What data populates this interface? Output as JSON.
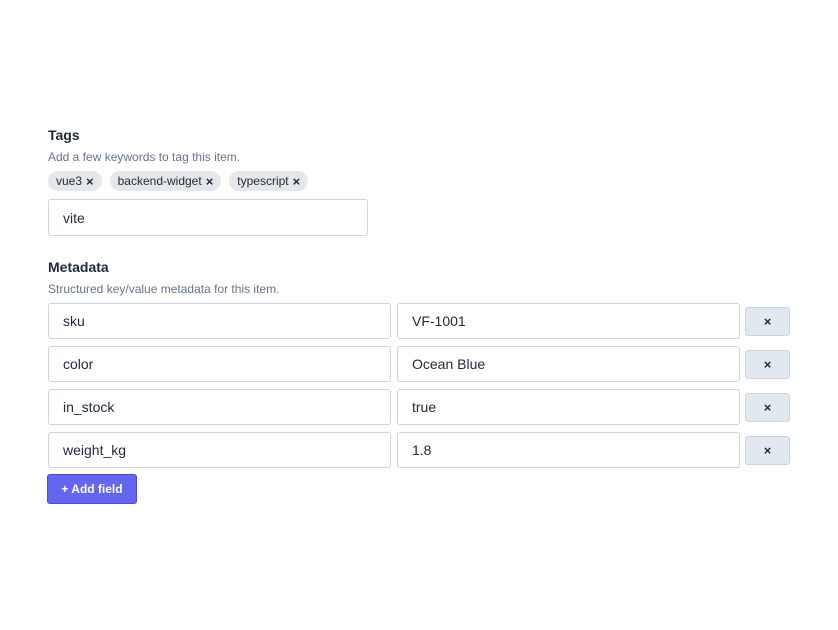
{
  "tags_section": {
    "title": "Tags",
    "help": "Add a few keywords to tag this item.",
    "tags": [
      {
        "label": "vue3",
        "remove_icon": "×"
      },
      {
        "label": "backend-widget",
        "remove_icon": "×"
      },
      {
        "label": "typescript",
        "remove_icon": "×"
      }
    ],
    "input_value": "vite"
  },
  "metadata_section": {
    "title": "Metadata",
    "help": "Structured key/value metadata for this item.",
    "rows": [
      {
        "key": "sku",
        "value": "VF-1001",
        "remove_label": "×"
      },
      {
        "key": "color",
        "value": "Ocean Blue",
        "remove_label": "×"
      },
      {
        "key": "in_stock",
        "value": "true",
        "remove_label": "×"
      },
      {
        "key": "weight_kg",
        "value": "1.8",
        "remove_label": "×"
      }
    ],
    "add_label": "+ Add field"
  },
  "colors": {
    "accent": "#6366f1",
    "tag_bg": "#e5e7eb",
    "help_text": "#64748b"
  },
  "icons": {
    "tag_remove": "close-icon",
    "row_remove": "close-icon"
  }
}
